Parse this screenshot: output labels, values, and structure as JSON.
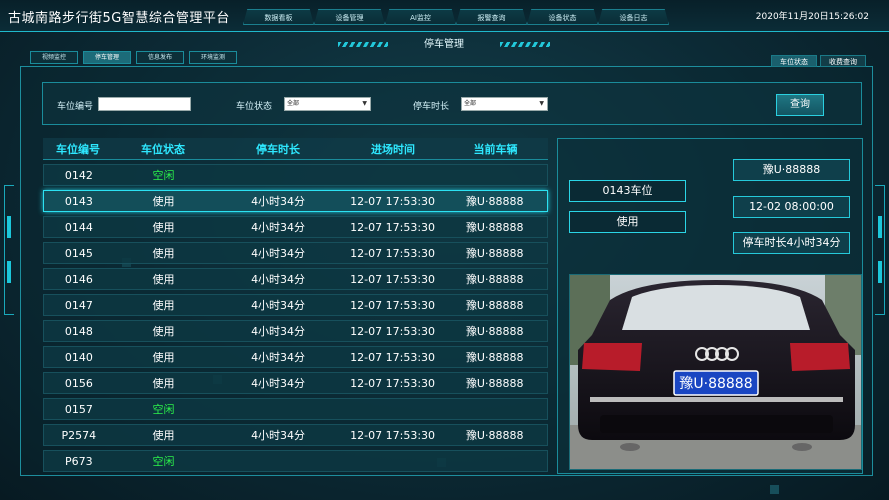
{
  "header": {
    "app_title": "古城南路步行街5G智慧综合管理平台",
    "datetime": "2020年11月20日15:26:02",
    "nav": [
      "数据看板",
      "设备管理",
      "AI监控",
      "报警查询",
      "设备状态",
      "设备日志"
    ]
  },
  "page_title": "停车管理",
  "sub_tabs": [
    "视频监控",
    "停车管理",
    "信息发布",
    "环境监测"
  ],
  "right_tabs": [
    "车位状态",
    "收费查询"
  ],
  "filter": {
    "space_label": "车位编号",
    "space_value": "",
    "status_label": "车位状态",
    "status_value": "全部",
    "duration_label": "停车时长",
    "duration_value": "全部",
    "query_label": "查询"
  },
  "table": {
    "headers": [
      "车位编号",
      "车位状态",
      "停车时长",
      "进场时间",
      "当前车辆"
    ],
    "rows": [
      {
        "id": "0142",
        "status": "空闲",
        "duration": "",
        "entry": "",
        "plate": ""
      },
      {
        "id": "0143",
        "status": "使用",
        "duration": "4小时34分",
        "entry": "12-07 17:53:30",
        "plate": "豫U·88888"
      },
      {
        "id": "0144",
        "status": "使用",
        "duration": "4小时34分",
        "entry": "12-07 17:53:30",
        "plate": "豫U·88888"
      },
      {
        "id": "0145",
        "status": "使用",
        "duration": "4小时34分",
        "entry": "12-07 17:53:30",
        "plate": "豫U·88888"
      },
      {
        "id": "0146",
        "status": "使用",
        "duration": "4小时34分",
        "entry": "12-07 17:53:30",
        "plate": "豫U·88888"
      },
      {
        "id": "0147",
        "status": "使用",
        "duration": "4小时34分",
        "entry": "12-07 17:53:30",
        "plate": "豫U·88888"
      },
      {
        "id": "0148",
        "status": "使用",
        "duration": "4小时34分",
        "entry": "12-07 17:53:30",
        "plate": "豫U·88888"
      },
      {
        "id": "0140",
        "status": "使用",
        "duration": "4小时34分",
        "entry": "12-07 17:53:30",
        "plate": "豫U·88888"
      },
      {
        "id": "0156",
        "status": "使用",
        "duration": "4小时34分",
        "entry": "12-07 17:53:30",
        "plate": "豫U·88888"
      },
      {
        "id": "0157",
        "status": "空闲",
        "duration": "",
        "entry": "",
        "plate": ""
      },
      {
        "id": "P2574",
        "status": "使用",
        "duration": "4小时34分",
        "entry": "12-07 17:53:30",
        "plate": "豫U·88888"
      },
      {
        "id": "P673",
        "status": "空闲",
        "duration": "",
        "entry": "",
        "plate": ""
      }
    ]
  },
  "detail": {
    "space": "0143车位",
    "status": "使用",
    "plate": "豫U·88888",
    "entry_time": "12-02  08:00:00",
    "duration": "停车时长4小时34分",
    "photo_plate": "豫U·88888"
  },
  "colors": {
    "accent": "#2ee8ff",
    "free": "#2bf04a",
    "border": "#1a8c9b"
  }
}
